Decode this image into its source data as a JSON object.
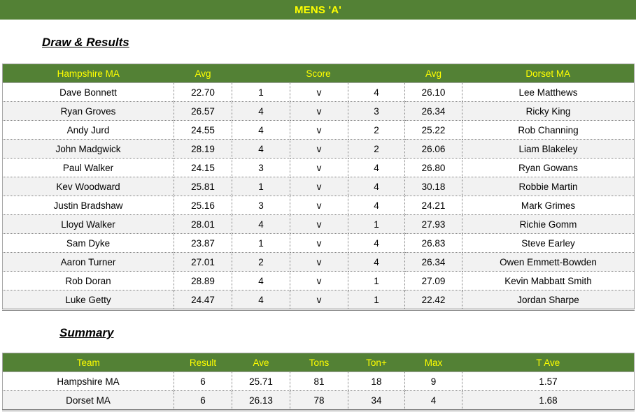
{
  "banner": {
    "title": "MENS 'A'",
    "bg_color": "#538135",
    "text_color": "#ffff00"
  },
  "sections": {
    "draw_results_heading": "Draw & Results",
    "summary_heading": "Summary"
  },
  "draw_table": {
    "headers": {
      "home_team": "Hampshire MA",
      "home_avg": "Avg",
      "score": "Score",
      "away_avg": "Avg",
      "away_team": "Dorset MA"
    },
    "rows": [
      {
        "home_player": "Dave Bonnett",
        "home_avg": "22.70",
        "home_score": "1",
        "v": "v",
        "away_score": "4",
        "away_avg": "26.10",
        "away_player": "Lee Matthews"
      },
      {
        "home_player": "Ryan Groves",
        "home_avg": "26.57",
        "home_score": "4",
        "v": "v",
        "away_score": "3",
        "away_avg": "26.34",
        "away_player": "Ricky King"
      },
      {
        "home_player": "Andy Jurd",
        "home_avg": "24.55",
        "home_score": "4",
        "v": "v",
        "away_score": "2",
        "away_avg": "25.22",
        "away_player": "Rob Channing"
      },
      {
        "home_player": "John Madgwick",
        "home_avg": "28.19",
        "home_score": "4",
        "v": "v",
        "away_score": "2",
        "away_avg": "26.06",
        "away_player": "Liam Blakeley"
      },
      {
        "home_player": "Paul Walker",
        "home_avg": "24.15",
        "home_score": "3",
        "v": "v",
        "away_score": "4",
        "away_avg": "26.80",
        "away_player": "Ryan Gowans"
      },
      {
        "home_player": "Kev Woodward",
        "home_avg": "25.81",
        "home_score": "1",
        "v": "v",
        "away_score": "4",
        "away_avg": "30.18",
        "away_player": "Robbie Martin"
      },
      {
        "home_player": "Justin Bradshaw",
        "home_avg": "25.16",
        "home_score": "3",
        "v": "v",
        "away_score": "4",
        "away_avg": "24.21",
        "away_player": "Mark Grimes"
      },
      {
        "home_player": "Lloyd Walker",
        "home_avg": "28.01",
        "home_score": "4",
        "v": "v",
        "away_score": "1",
        "away_avg": "27.93",
        "away_player": "Richie Gomm"
      },
      {
        "home_player": "Sam Dyke",
        "home_avg": "23.87",
        "home_score": "1",
        "v": "v",
        "away_score": "4",
        "away_avg": "26.83",
        "away_player": "Steve Earley"
      },
      {
        "home_player": "Aaron Turner",
        "home_avg": "27.01",
        "home_score": "2",
        "v": "v",
        "away_score": "4",
        "away_avg": "26.34",
        "away_player": "Owen Emmett-Bowden"
      },
      {
        "home_player": "Rob Doran",
        "home_avg": "28.89",
        "home_score": "4",
        "v": "v",
        "away_score": "1",
        "away_avg": "27.09",
        "away_player": "Kevin Mabbatt Smith"
      },
      {
        "home_player": "Luke Getty",
        "home_avg": "24.47",
        "home_score": "4",
        "v": "v",
        "away_score": "1",
        "away_avg": "22.42",
        "away_player": "Jordan Sharpe"
      }
    ]
  },
  "summary_table": {
    "headers": {
      "team": "Team",
      "result": "Result",
      "ave": "Ave",
      "tons": "Tons",
      "ton_plus": "Ton+",
      "max": "Max",
      "t_ave": "T Ave"
    },
    "rows": [
      {
        "team": "Hampshire MA",
        "result": "6",
        "ave": "25.71",
        "tons": "81",
        "ton_plus": "18",
        "max": "9",
        "t_ave": "1.57"
      },
      {
        "team": "Dorset MA",
        "result": "6",
        "ave": "26.13",
        "tons": "78",
        "ton_plus": "34",
        "max": "4",
        "t_ave": "1.68"
      }
    ]
  }
}
